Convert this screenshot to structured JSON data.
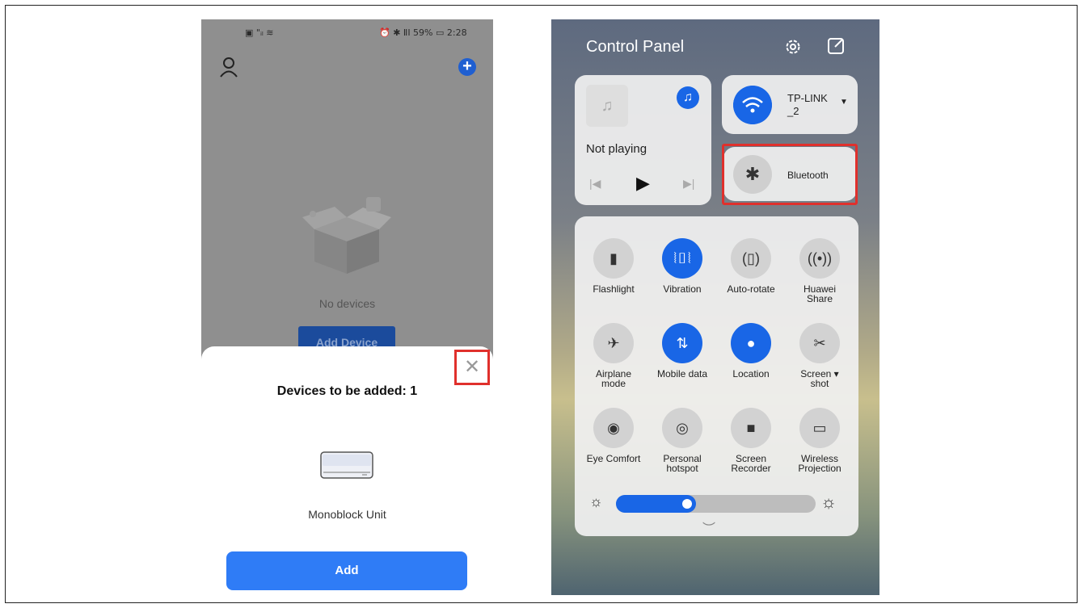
{
  "left": {
    "status_left": "▣ \"ᵢₗ ≋",
    "status_right": "⏰ ✱ ⅡI 59% ▭ 2:28",
    "empty_text": "No devices",
    "add_device_label": "Add Device",
    "sheet_title": "Devices to be added: 1",
    "close_glyph": "✕",
    "unit_name": "Monoblock Unit",
    "add_label": "Add"
  },
  "right": {
    "title": "Control Panel",
    "media": {
      "music_glyph": "♫",
      "status": "Not playing",
      "prev": "|◀",
      "play": "▶",
      "next": "▶|"
    },
    "wifi": {
      "name": "TP-LINK\n_2",
      "caret": "▼"
    },
    "bluetooth": {
      "glyph": "✱",
      "label": "Bluetooth"
    },
    "tiles": [
      {
        "label": "Flashlight",
        "glyph": "▮",
        "on": false
      },
      {
        "label": "Vibration",
        "glyph": "⦚▯⦚",
        "on": true
      },
      {
        "label": "Auto-rotate",
        "glyph": "(▯)",
        "on": false
      },
      {
        "label": "Huawei\nShare",
        "glyph": "((•))",
        "on": false
      },
      {
        "label": "Airplane\nmode",
        "glyph": "✈",
        "on": false
      },
      {
        "label": "Mobile data",
        "glyph": "⇅",
        "on": true
      },
      {
        "label": "Location",
        "glyph": "●",
        "on": true
      },
      {
        "label": "Screen ▾\nshot",
        "glyph": "✂",
        "on": false
      },
      {
        "label": "Eye Comfort",
        "glyph": "◉",
        "on": false
      },
      {
        "label": "Personal\nhotspot",
        "glyph": "◎",
        "on": false
      },
      {
        "label": "Screen\nRecorder",
        "glyph": "■",
        "on": false
      },
      {
        "label": "Wireless\nProjection",
        "glyph": "▭",
        "on": false
      }
    ],
    "brightness": 0.4,
    "sun_glyph": "☼",
    "chevron": "︶"
  },
  "colors": {
    "accent": "#1966e6",
    "highlight": "#e0302c",
    "add_button": "#2f7cf6"
  }
}
